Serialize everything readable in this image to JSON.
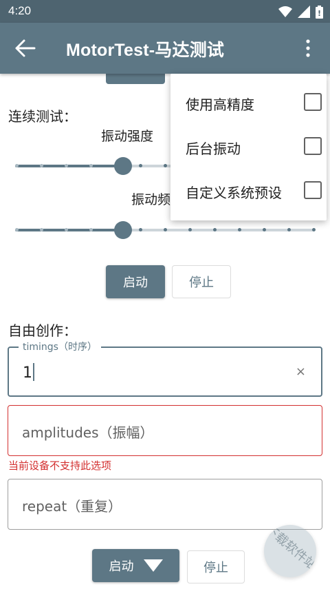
{
  "status_bar": {
    "time": "4:20"
  },
  "toolbar": {
    "title": "MotorTest-马达测试"
  },
  "continuous": {
    "section_label": "连续测试：",
    "intensity_label": "振动强度",
    "intensity_level": 0.36,
    "frequency_label": "振动频",
    "frequency_level": 0.36,
    "start_label": "启动",
    "stop_label": "停止"
  },
  "free": {
    "section_label": "自由创作：",
    "timings_legend": "timings（时序）",
    "timings_value": "1",
    "clear_symbol": "×",
    "amplitudes_placeholder": "amplitudes（振幅）",
    "amplitudes_error": "当前设备不支持此选项",
    "repeat_placeholder": "repeat（重复）",
    "start_label": "启动",
    "stop_label": "停止"
  },
  "menu": {
    "items": [
      {
        "label": "使用高精度",
        "checked": false
      },
      {
        "label": "后台振动",
        "checked": false
      },
      {
        "label": "自定义系统预设",
        "checked": false
      }
    ]
  },
  "watermark": {
    "text": "下载软件站"
  },
  "colors": {
    "primary": "#5d7785",
    "primary_dark": "#4e6470",
    "track": "#cdd5da",
    "error": "#d32f2f"
  },
  "icons": [
    "back-arrow-icon",
    "more-vert-icon",
    "wifi-icon",
    "signal-icon",
    "battery-icon",
    "dropdown-triangle-icon"
  ]
}
